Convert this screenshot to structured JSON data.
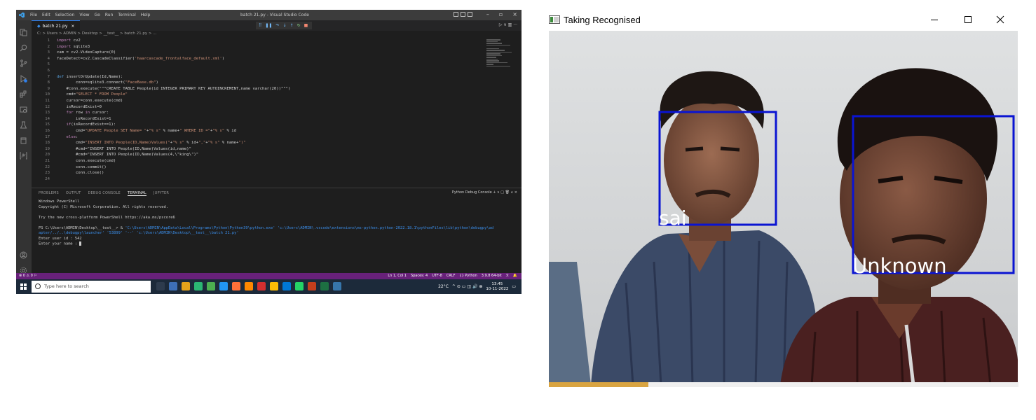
{
  "vscode": {
    "title": "batch 21.py - Visual Studio Code",
    "menu": [
      "File",
      "Edit",
      "Selection",
      "View",
      "Go",
      "Run",
      "Terminal",
      "Help"
    ],
    "tab_label": "batch 21.py",
    "tab_close": "×",
    "breadcrumb": "C: > Users > ADMIN > Desktop > __test__ > batch 21.py > ...",
    "code_lines": [
      {
        "n": "1",
        "text": "import cv2"
      },
      {
        "n": "2",
        "text": "import sqlite3"
      },
      {
        "n": "3",
        "text": "cam = cv2.VideoCapture(0)"
      },
      {
        "n": "4",
        "text": "faceDetect=cv2.CascadeClassifier('haarcascade_frontalface_default.xml')"
      },
      {
        "n": "5",
        "text": ""
      },
      {
        "n": "6",
        "text": ""
      },
      {
        "n": "7",
        "text": "def insertOrUpdate(Id,Name):"
      },
      {
        "n": "8",
        "text": "        conn=sqlite3.connect(\"FaceBase.db\")"
      },
      {
        "n": "9",
        "text": "    #conn.execute(\"\"\"CREATE TABLE People(id INTEGER PRIMARY KEY AUTOINCREMENT,name varchar(20))\"\"\")"
      },
      {
        "n": "10",
        "text": "    cmd=\"SELECT * FROM People\""
      },
      {
        "n": "11",
        "text": "    cursor=conn.execute(cmd)"
      },
      {
        "n": "12",
        "text": "    isRecordExist=0"
      },
      {
        "n": "13",
        "text": "    for row in cursor:"
      },
      {
        "n": "14",
        "text": "        isRecordExist=1"
      },
      {
        "n": "15",
        "text": "    if(isRecordExist==1):"
      },
      {
        "n": "16",
        "text": "        cmd=\"UPDATE People SET Name= \"+\"% s\" % name+\" WHERE ID =\"+\"% s\" % id"
      },
      {
        "n": "17",
        "text": "    else:"
      },
      {
        "n": "18",
        "text": "        cmd=\"INSERT INTO People(ID,Name)Values(\"+\"% s\" % id+\",\"+\"% s\" % name+\")\""
      },
      {
        "n": "19",
        "text": "        #cmd=\"INSERT INTO People(ID,Name)Values(id,name)\""
      },
      {
        "n": "20",
        "text": "        #cmd=\"INSERT INTO People(ID,Name)Values(4,\\\"king\\\")\""
      },
      {
        "n": "21",
        "text": "        conn.execute(cmd)"
      },
      {
        "n": "22",
        "text": "        conn.commit()"
      },
      {
        "n": "23",
        "text": "        conn.close()"
      },
      {
        "n": "24",
        "text": ""
      }
    ],
    "panel_tabs": [
      "PROBLEMS",
      "OUTPUT",
      "DEBUG CONSOLE",
      "TERMINAL",
      "JUPYTER"
    ],
    "panel_active_tab": "TERMINAL",
    "panel_right": "Python Debug Console  +  ∨  □  🗑  ∧  ×",
    "terminal": {
      "line1": "Windows PowerShell",
      "line2": "Copyright (C) Microsoft Corporation. All rights reserved.",
      "line3": "",
      "line4": "Try the new cross-platform PowerShell https://aka.ms/pscore6",
      "line5": "",
      "prompt": "PS C:\\Users\\ADMIN\\Desktop\\__test__> & ",
      "cmd": "'C:\\Users\\ADMIN\\AppData\\Local\\Programs\\Python\\Python39\\python.exe' 'c:\\Users\\ADMIN\\.vscode\\extensions\\ms-python.python-2022.18.1\\pythonFiles\\lib\\python\\debugpy\\ad",
      "cmd2": "apter/../..\\debugpy\\launcher' '53899' '--' 'c:\\Users\\ADMIN\\Desktop\\__test__\\batch 21.py'",
      "line8": "Enter user id : 542",
      "line9": "Enter your name : "
    },
    "status_left": "⊗ 0 ⚠ 0   ⚐",
    "status_right": [
      "Ln 1, Col 1",
      "Spaces: 4",
      "UTF-8",
      "CRLF",
      "{} Python",
      "3.9.8 64-bit",
      "ℛ",
      "🔔"
    ],
    "taskbar": {
      "search_placeholder": "Type here to search",
      "weather": "22°C",
      "time": "13:45",
      "date": "10-11-2022"
    },
    "colors": {
      "statusbar": "#68217a",
      "editor_bg": "#1e1e1e",
      "taskbar": "#1c2a3a"
    }
  },
  "recognition": {
    "window_title": "Taking Recognised",
    "min_label": "—",
    "faces": [
      {
        "label": "sai"
      },
      {
        "label": "Unknown"
      }
    ],
    "box_color": "#0a14d2"
  }
}
